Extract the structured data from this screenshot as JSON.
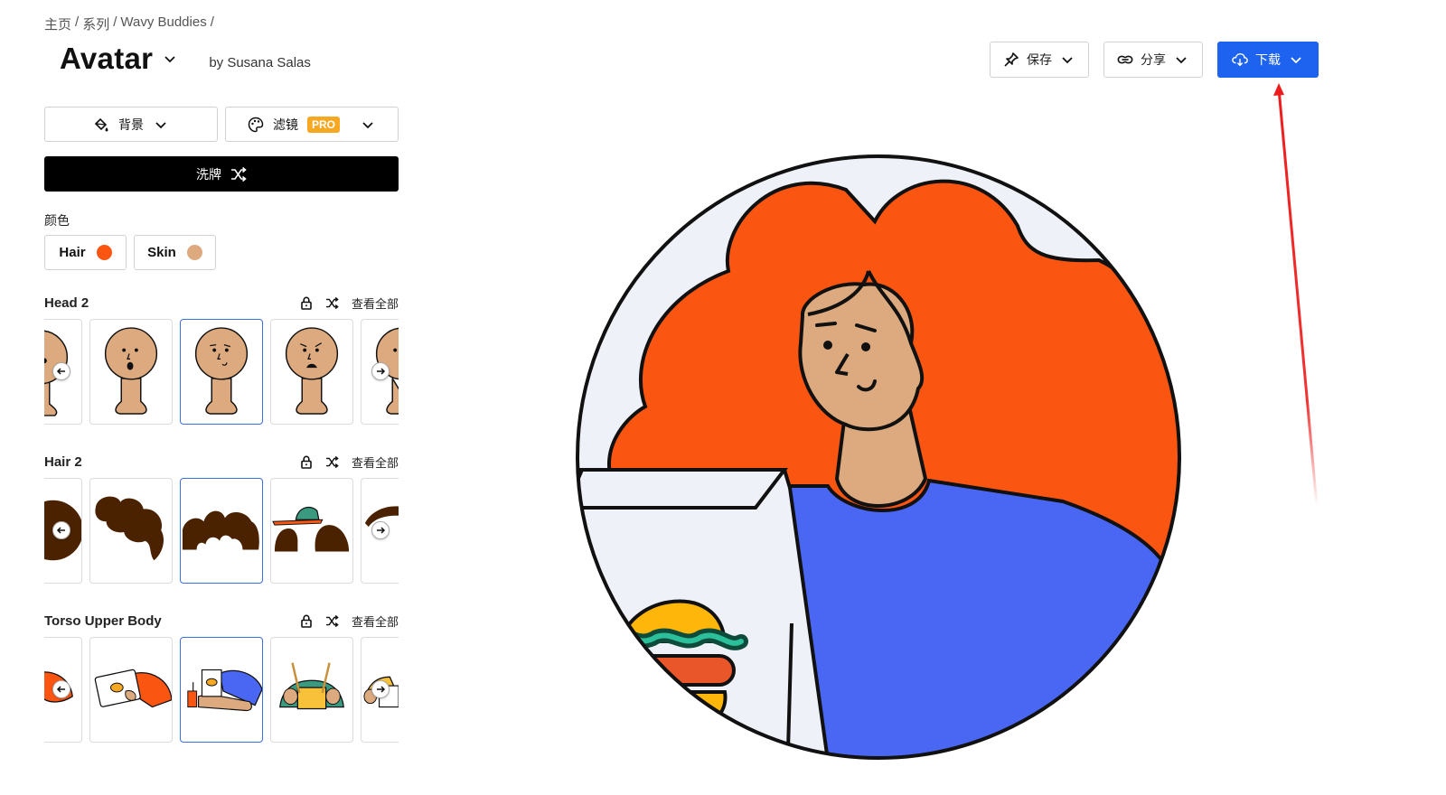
{
  "breadcrumb": {
    "items": [
      "主页",
      "系列",
      "Wavy Buddies"
    ],
    "separator": "/"
  },
  "header": {
    "title": "Avatar",
    "author": "by Susana Salas"
  },
  "actions": {
    "save_label": "保存",
    "share_label": "分享",
    "download_label": "下载"
  },
  "toolbar": {
    "background_label": "背景",
    "filter_label": "滤镜",
    "pro_badge": "PRO",
    "shuffle_label": "洗牌"
  },
  "colors": {
    "label": "颜色",
    "chips": [
      {
        "label": "Hair",
        "swatch": "#fb5512"
      },
      {
        "label": "Skin",
        "swatch": "#dcaa7e"
      }
    ]
  },
  "sections": [
    {
      "title": "Head 2",
      "view_all": "查看全部"
    },
    {
      "title": "Hair 2",
      "view_all": "查看全部"
    },
    {
      "title": "Torso Upper Body",
      "view_all": "查看全部"
    }
  ],
  "palette": {
    "accent": "#1d63f0",
    "hair": "#fb5512",
    "skin": "#dcaa7e",
    "shirt": "#4a67f4",
    "bg": "#eef1f7",
    "dark_hair": "#4a2200"
  }
}
